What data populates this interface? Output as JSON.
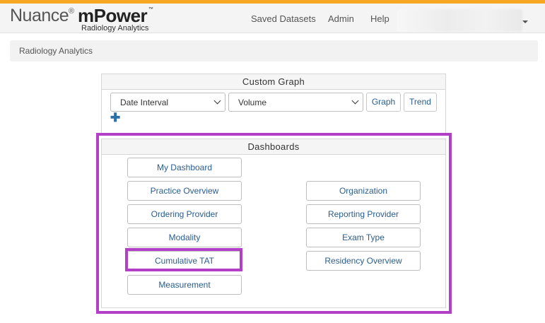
{
  "brand": {
    "nuance": "Nuance",
    "registered": "®",
    "mpower": "mPower",
    "trademark": "™",
    "subtitle": "Radiology Analytics"
  },
  "nav": {
    "saved_datasets": "Saved Datasets",
    "admin": "Admin",
    "help": "Help"
  },
  "breadcrumb": "Radiology Analytics",
  "custom_graph": {
    "title": "Custom Graph",
    "interval_select": "Date Interval",
    "measure_select": "Volume",
    "graph_button": "Graph",
    "trend_button": "Trend",
    "add_symbol": "✚"
  },
  "dashboards": {
    "title": "Dashboards",
    "left": [
      "My Dashboard",
      "Practice Overview",
      "Ordering Provider",
      "Modality",
      "Cumulative TAT",
      "Measurement"
    ],
    "right": [
      "Organization",
      "Reporting Provider",
      "Exam Type",
      "Residency Overview"
    ]
  },
  "colors": {
    "accent_bar": "#f5a623",
    "highlight": "#b43fc7",
    "link": "#2a5d8f"
  }
}
